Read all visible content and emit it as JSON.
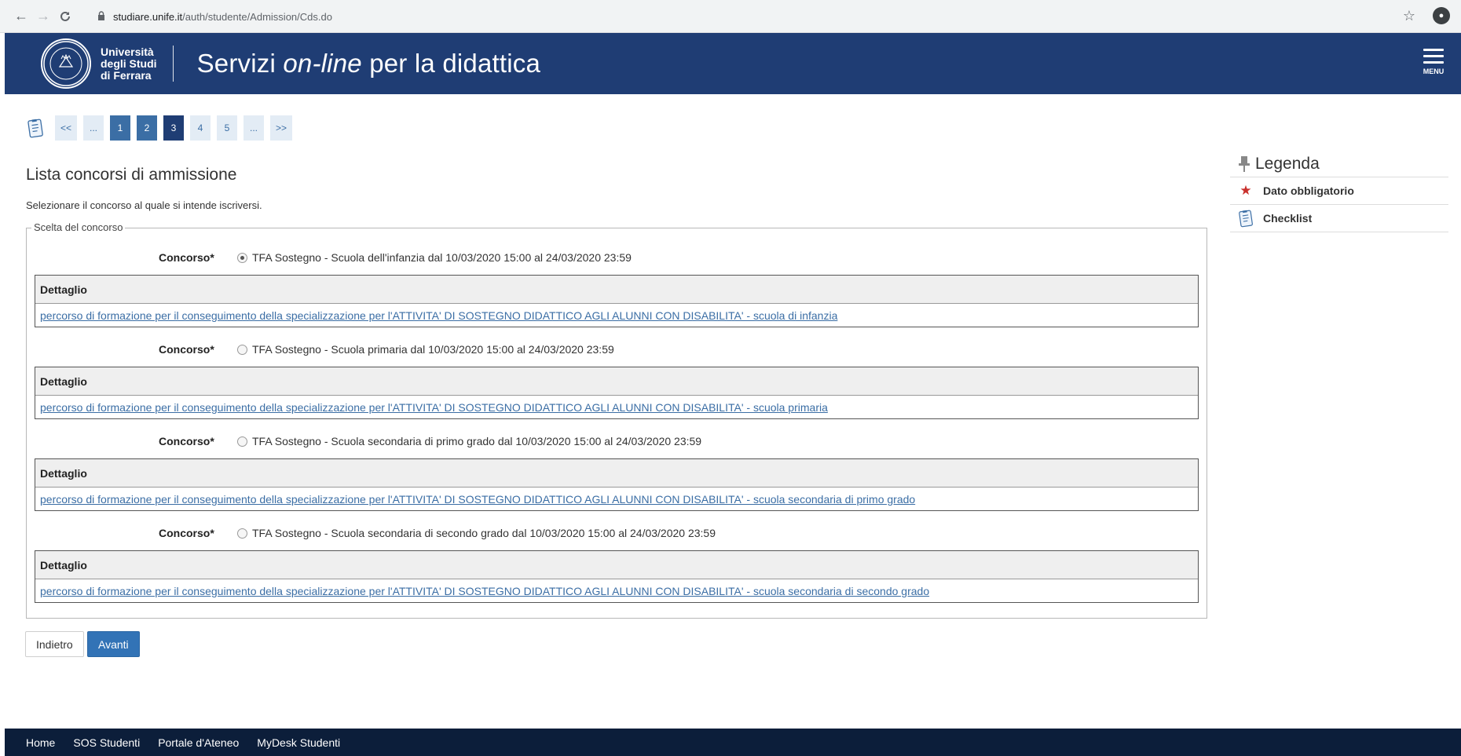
{
  "browser": {
    "url_host": "studiare.unife.it",
    "url_path": "/auth/studente/Admission/Cds.do",
    "back_icon": "←",
    "forward_icon": "→",
    "reload_icon": "C",
    "lock_icon": "🔒",
    "star_icon": "☆"
  },
  "header": {
    "university_line1": "Università",
    "university_line2": "degli Studi",
    "university_line3": "di Ferrara",
    "title_before": "Servizi ",
    "title_italic": "on-line",
    "title_after": " per la didattica",
    "menu_label": "MENU",
    "brand_color": "#1f3d74"
  },
  "pager": {
    "items": [
      "<<",
      "...",
      "1",
      "2",
      "3",
      "4",
      "5",
      "...",
      ">>"
    ],
    "current": "3"
  },
  "main": {
    "title": "Lista concorsi di ammissione",
    "subtitle": "Selezionare il concorso al quale si intende iscriversi.",
    "fieldset_legend": "Scelta del concorso",
    "concorso_label": "Concorso*",
    "detail_label": "Dettaglio",
    "concorsi": [
      {
        "option": "TFA Sostegno - Scuola dell'infanzia dal 10/03/2020 15:00 al 24/03/2020 23:59",
        "selected": true,
        "detail": "percorso di formazione per il conseguimento della specializzazione per l'ATTIVITA' DI SOSTEGNO DIDATTICO AGLI ALUNNI CON DISABILITA' - scuola di infanzia"
      },
      {
        "option": "TFA Sostegno - Scuola primaria dal 10/03/2020 15:00 al 24/03/2020 23:59",
        "selected": false,
        "detail": "percorso di formazione per il conseguimento della specializzazione per l'ATTIVITA' DI SOSTEGNO DIDATTICO AGLI ALUNNI CON DISABILITA' - scuola primaria"
      },
      {
        "option": "TFA Sostegno - Scuola secondaria di primo grado dal 10/03/2020 15:00 al 24/03/2020 23:59",
        "selected": false,
        "detail": "percorso di formazione per il conseguimento della specializzazione per l'ATTIVITA' DI SOSTEGNO DIDATTICO AGLI ALUNNI CON DISABILITA' - scuola secondaria di primo grado"
      },
      {
        "option": "TFA Sostegno - Scuola secondaria di secondo grado dal 10/03/2020 15:00 al 24/03/2020 23:59",
        "selected": false,
        "detail": "percorso di formazione per il conseguimento della specializzazione per l'ATTIVITA' DI SOSTEGNO DIDATTICO AGLI ALUNNI CON DISABILITA' - scuola secondaria di secondo grado"
      }
    ],
    "back_button": "Indietro",
    "next_button": "Avanti",
    "accent_color": "#3273b6"
  },
  "legenda": {
    "title": "Legenda",
    "items": [
      {
        "icon": "required-star-icon",
        "label": "Dato obbligatorio"
      },
      {
        "icon": "checklist-icon",
        "label": "Checklist"
      }
    ]
  },
  "footer": {
    "links": [
      "Home",
      "SOS Studenti",
      "Portale d'Ateneo",
      "MyDesk Studenti"
    ]
  }
}
